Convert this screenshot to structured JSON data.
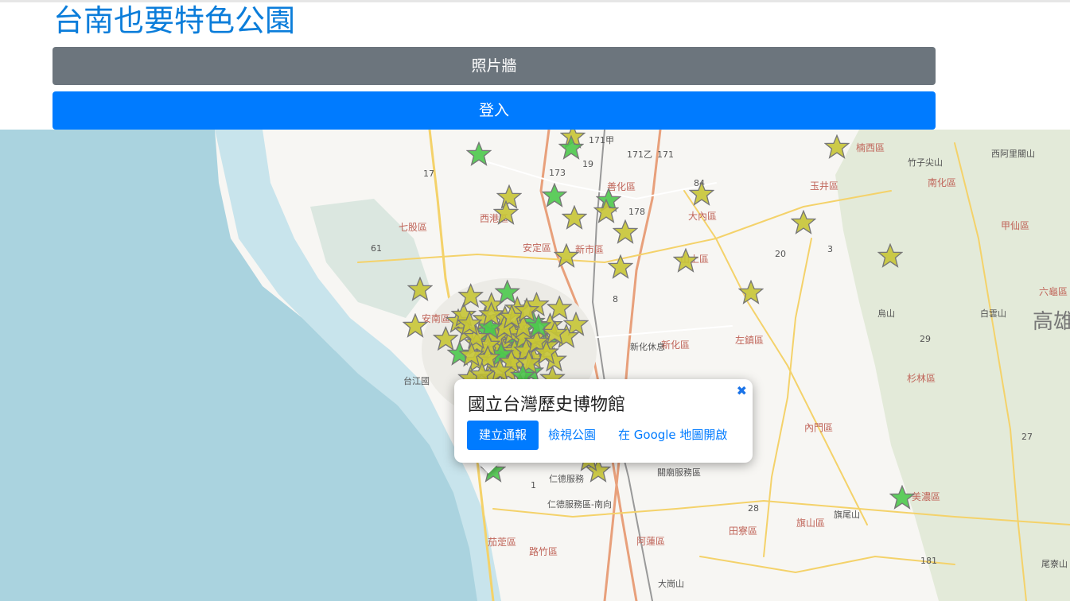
{
  "page": {
    "title": "台南也要特色公園",
    "photo_wall_label": "照片牆",
    "login_label": "登入"
  },
  "popup": {
    "title": "國立台灣歷史博物館",
    "close_icon": "✖",
    "report_button": "建立通報",
    "view_park_link": "檢視公園",
    "google_maps_link": "在 Google 地圖開啟"
  },
  "map": {
    "district_labels": [
      "楠西區",
      "南化區",
      "玉井區",
      "甲仙區",
      "七股區",
      "西港區",
      "善化區",
      "大內區",
      "安定區",
      "新市區",
      "山上區",
      "安南區",
      "新化區",
      "左鎮區",
      "杉林區",
      "內門區",
      "台江國",
      "田寮區",
      "旗山區",
      "美濃區",
      "茄萣區",
      "路竹區",
      "阿蓮區",
      "六龜區",
      "高雄"
    ],
    "mountain_labels": [
      "竹子尖山",
      "西阿里關山",
      "烏山",
      "白雲山",
      "旗尾山",
      "大崗山",
      "尾寮山"
    ],
    "road_labels": [
      "171甲",
      "171乙",
      "171",
      "173",
      "19",
      "178",
      "84",
      "20",
      "3",
      "61",
      "17",
      "29",
      "27",
      "1",
      "28",
      "181",
      "8",
      "新化休息",
      "仁德服務",
      "仁德服務區-南向",
      "關廟服務區"
    ],
    "colors": {
      "star_yellow": "#c7c535",
      "star_green": "#4cc94c",
      "sea": "#aad3df",
      "land": "#f7f6f3"
    }
  }
}
